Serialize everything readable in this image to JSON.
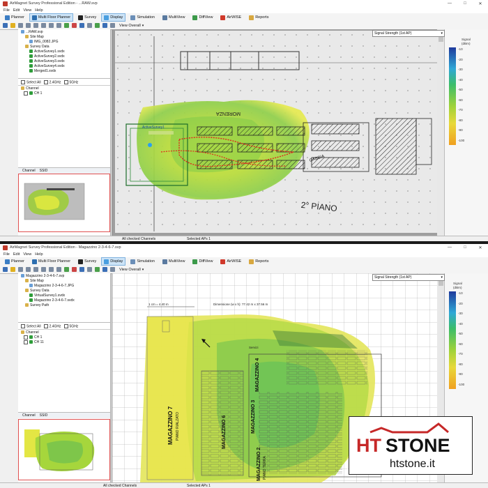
{
  "top": {
    "title": "AirMagnet Survey Professional Edition - ...RAW.svp",
    "menu": [
      "File",
      "Edit",
      "View",
      "Help"
    ],
    "toolbar": [
      "Planner",
      "Multi Floor Planner",
      "Survey",
      "Display",
      "Simulation",
      "MultiView",
      "DiffView",
      "AirWISE",
      "Reports"
    ],
    "view_mode": "View Overall",
    "signal_select": "Signal Strength (1st AP)",
    "legend_title": "Signal",
    "legend_unit": "(dBm)",
    "legend_ticks": [
      "-10",
      "-20",
      "-30",
      "-40",
      "-50",
      "-60",
      "-70",
      "-80",
      "-90",
      "-100"
    ],
    "tree": [
      {
        "label": "...RAW.svp",
        "indent": 0,
        "icon": "file"
      },
      {
        "label": "Site Map",
        "indent": 1,
        "icon": "folder"
      },
      {
        "label": "IMG_0082.JPG",
        "indent": 2,
        "icon": "image"
      },
      {
        "label": "Survey Data",
        "indent": 1,
        "icon": "folder"
      },
      {
        "label": "ActiveSurvey1.svdx",
        "indent": 2,
        "icon": "survey"
      },
      {
        "label": "ActiveSurvey2.svdx",
        "indent": 2,
        "icon": "survey"
      },
      {
        "label": "ActiveSurvey3.svdx",
        "indent": 2,
        "icon": "survey"
      },
      {
        "label": "ActiveSurvey4.svdx",
        "indent": 2,
        "icon": "survey"
      },
      {
        "label": "Merged1.svdx",
        "indent": 2,
        "icon": "survey"
      }
    ],
    "bands": [
      "Select All",
      "2.4GHz",
      "5GHz"
    ],
    "channel_header": "Channel",
    "channels": [
      "CH 1"
    ],
    "tabs": [
      "Channel",
      "SSID"
    ],
    "status_left": "All checked Channels",
    "status_mid": "Selected APs 1",
    "plan_labels": {
      "scale": "2° PIANO",
      "ap": "ActiveSurvey1",
      "gabbia": "GABBIA",
      "tl": "MORENZA"
    }
  },
  "bottom": {
    "title": "AirMagnet Survey Professional Edition - Magazzino 2-3-4-6-7.svp",
    "menu": [
      "File",
      "Edit",
      "View",
      "Help"
    ],
    "toolbar": [
      "Planner",
      "Multi Floor Planner",
      "Survey",
      "Display",
      "Simulation",
      "MultiView",
      "DiffView",
      "AirWISE",
      "Reports"
    ],
    "view_mode": "View Overall",
    "signal_select": "Signal Strength (1st AP)",
    "legend_title": "Signal",
    "legend_unit": "(dBm)",
    "legend_ticks": [
      "-10",
      "-20",
      "-30",
      "-40",
      "-50",
      "-60",
      "-70",
      "-80",
      "-90",
      "-100"
    ],
    "tree": [
      {
        "label": "Magazzino 2-3-4-6-7.svp",
        "indent": 0,
        "icon": "file"
      },
      {
        "label": "Site Map",
        "indent": 1,
        "icon": "folder"
      },
      {
        "label": "Magazzino 2-3-4-6-7.JPG",
        "indent": 2,
        "icon": "image"
      },
      {
        "label": "Survey Data",
        "indent": 1,
        "icon": "folder"
      },
      {
        "label": "VirtualSurvey1.svdx",
        "indent": 2,
        "icon": "survey"
      },
      {
        "label": "Magazzino 2-3-4-6-7.svdx",
        "indent": 2,
        "icon": "survey"
      },
      {
        "label": "Survey Path",
        "indent": 1,
        "icon": "folder"
      }
    ],
    "bands": [
      "Select All",
      "2.4GHz",
      "5GHz"
    ],
    "channel_header": "Channel",
    "channels": [
      "CH 1",
      "CH 11"
    ],
    "tabs": [
      "Channel",
      "SSID"
    ],
    "status_left": "All checked Channels",
    "status_mid": "Selected APs 1",
    "measure_1": "1 cm = 4.40 m",
    "measure_2": "Dimensione (w x h): 77.42 m x 37.56 m",
    "plan_labels": {
      "m7": "MAGAZZINO 7",
      "m7b": "PIANO RIALZATO",
      "m6": "MAGAZZINO 6",
      "m3": "MAGAZZINO 3",
      "m4": "MAGAZZINO 4",
      "m2": "MAGAZZINO 2",
      "m2b": "PIANO TERRA",
      "servizi": "Servizi"
    }
  },
  "logo": {
    "brand_ht": "HT",
    "brand_stone": "STONE",
    "url": "htstone.it",
    "accent": "#c62828"
  }
}
